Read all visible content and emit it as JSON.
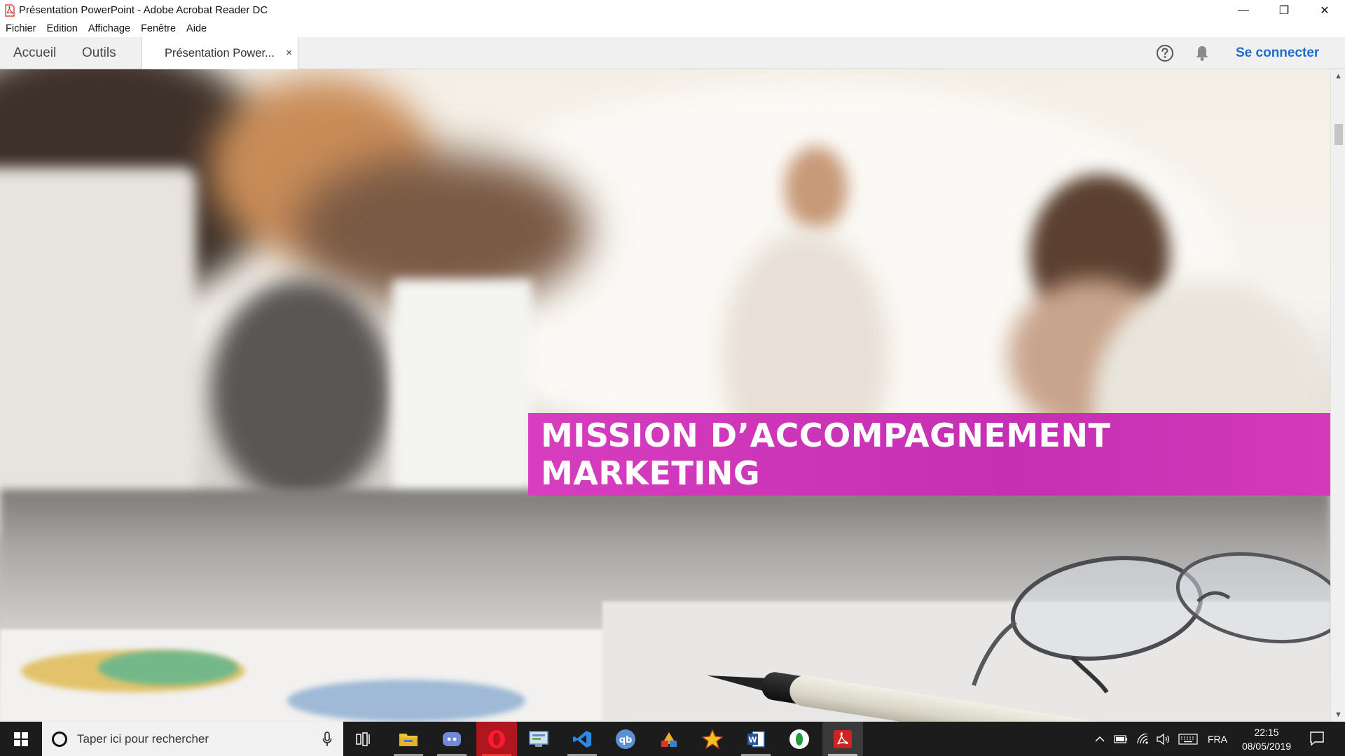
{
  "window": {
    "title": "Présentation PowerPoint - Adobe Acrobat Reader DC",
    "minimize": "—",
    "restore": "❐",
    "close": "✕"
  },
  "menu": [
    "Fichier",
    "Edition",
    "Affichage",
    "Fenêtre",
    "Aide"
  ],
  "toolbar": {
    "home_tab": "Accueil",
    "tools_tab": "Outils",
    "document_tab": "Présentation Power...",
    "document_tab_close": "×",
    "signin": "Se connecter"
  },
  "document": {
    "slide_title": "MISSION D’ACCOMPAGNEMENT MARKETING",
    "banner_color": "#c932b6"
  },
  "scrollbar": {
    "up": "▲",
    "down": "▼"
  },
  "taskbar": {
    "search_placeholder": "Taper ici pour rechercher",
    "apps": [
      "task-view",
      "file-explorer",
      "discord",
      "opera",
      "control-panel",
      "vscode",
      "qbittorrent",
      "paint-app",
      "star-app",
      "word",
      "green-app",
      "acrobat-reader"
    ],
    "language": "FRA",
    "time": "22:15",
    "date": "08/05/2019"
  },
  "colors": {
    "accent_blue": "#1b6fcf",
    "taskbar": "#1c1c1c",
    "banner": "#c932b6"
  }
}
